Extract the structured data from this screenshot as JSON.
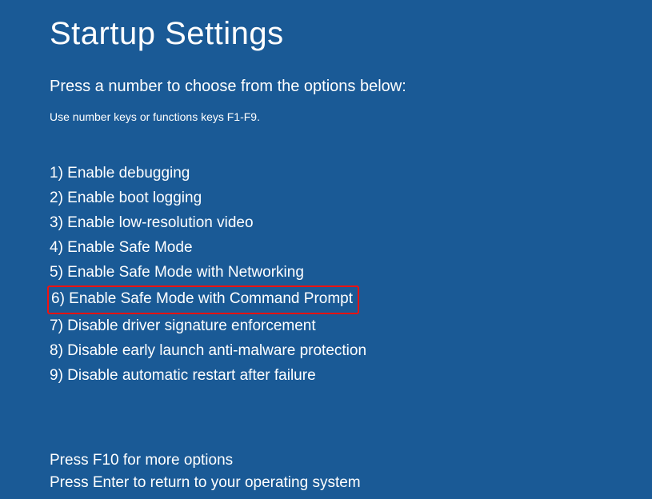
{
  "title": "Startup Settings",
  "instruction": "Press a number to choose from the options below:",
  "hint": "Use number keys or functions keys F1-F9.",
  "options": [
    {
      "num": "1)",
      "label": "Enable debugging",
      "highlighted": false
    },
    {
      "num": "2)",
      "label": "Enable boot logging",
      "highlighted": false
    },
    {
      "num": "3)",
      "label": "Enable low-resolution video",
      "highlighted": false
    },
    {
      "num": "4)",
      "label": "Enable Safe Mode",
      "highlighted": false
    },
    {
      "num": "5)",
      "label": "Enable Safe Mode with Networking",
      "highlighted": false
    },
    {
      "num": "6)",
      "label": "Enable Safe Mode with Command Prompt",
      "highlighted": true
    },
    {
      "num": "7)",
      "label": "Disable driver signature enforcement",
      "highlighted": false
    },
    {
      "num": "8)",
      "label": "Disable early launch anti-malware protection",
      "highlighted": false
    },
    {
      "num": "9)",
      "label": "Disable automatic restart after failure",
      "highlighted": false
    }
  ],
  "footer": {
    "more": "Press F10 for more options",
    "return": "Press Enter to return to your operating system"
  }
}
